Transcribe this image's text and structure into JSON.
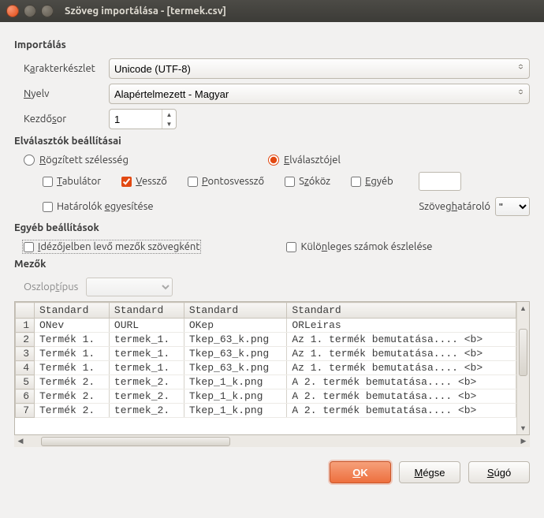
{
  "window": {
    "title": "Szöveg importálása - [termek.csv]"
  },
  "import": {
    "section": "Importálás",
    "charset_label_pre": "K",
    "charset_label_u": "a",
    "charset_label_post": "rakterkészlet",
    "charset_value": "Unicode (UTF-8)",
    "lang_label_pre": "",
    "lang_label_u": "N",
    "lang_label_post": "yelv",
    "lang_value": "Alapértelmezett - Magyar",
    "startrow_label_pre": "Kezdő",
    "startrow_label_u": "s",
    "startrow_label_post": "or",
    "startrow_value": "1"
  },
  "separators": {
    "section": "Elválasztók beállításai",
    "fixed_pre": "",
    "fixed_u": "R",
    "fixed_post": "ögzített szélesség",
    "delim_pre": "",
    "delim_u": "E",
    "delim_post": "lválasztójel",
    "tab_pre": "",
    "tab_u": "T",
    "tab_post": "abulátor",
    "comma_pre": "",
    "comma_u": "V",
    "comma_post": "essző",
    "semi_pre": "",
    "semi_u": "P",
    "semi_post": "ontosvessző",
    "space_pre": "S",
    "space_u": "z",
    "space_post": "óköz",
    "other_pre": "",
    "other_u": "E",
    "other_post": "gyéb",
    "other_value": "",
    "merge_pre": "Határolók ",
    "merge_u": "e",
    "merge_post": "gyesítése",
    "textdelim_label_pre": "Szöveg",
    "textdelim_label_u": "h",
    "textdelim_label_post": "atároló",
    "textdelim_value": "\""
  },
  "other": {
    "section": "Egyéb beállítások",
    "quoted_pre": "",
    "quoted_u": "I",
    "quoted_post": "dézőjelben levő mezők szövegként",
    "special_pre": "Külö",
    "special_u": "n",
    "special_post": "leges számok észlelése"
  },
  "fields": {
    "section": "Mezők",
    "coltype_label_pre": "Oszlop",
    "coltype_label_u": "t",
    "coltype_label_post": "ípus",
    "coltype_value": "",
    "headers": [
      "Standard",
      "Standard",
      "Standard",
      "Standard"
    ],
    "rows": [
      [
        "ONev",
        "OURL",
        "OKep",
        "ORLeiras"
      ],
      [
        "Termék 1.",
        "termek_1.",
        "Tkep_63_k.png",
        "Az 1.  termék bemutatása....  <b>"
      ],
      [
        "Termék 1.",
        "termek_1.",
        "Tkep_63_k.png",
        "Az 1.  termék bemutatása....  <b>"
      ],
      [
        "Termék 1.",
        "termek_1.",
        "Tkep_63_k.png",
        "Az 1.  termék bemutatása....  <b>"
      ],
      [
        "Termék 2.",
        "termek_2.",
        "Tkep_1_k.png",
        "A 2.  termék bemutatása....  <b>"
      ],
      [
        "Termék 2.",
        "termek_2.",
        "Tkep_1_k.png",
        "A 2.  termék bemutatása....  <b>"
      ],
      [
        "Termék 2.",
        "termek_2.",
        "Tkep_1_k.png",
        "A 2.  termék bemutatása....  <b>"
      ]
    ]
  },
  "buttons": {
    "ok_pre": "",
    "ok_u": "O",
    "ok_post": "K",
    "cancel_pre": "",
    "cancel_u": "M",
    "cancel_post": "égse",
    "help_pre": "",
    "help_u": "S",
    "help_post": "úgó"
  }
}
